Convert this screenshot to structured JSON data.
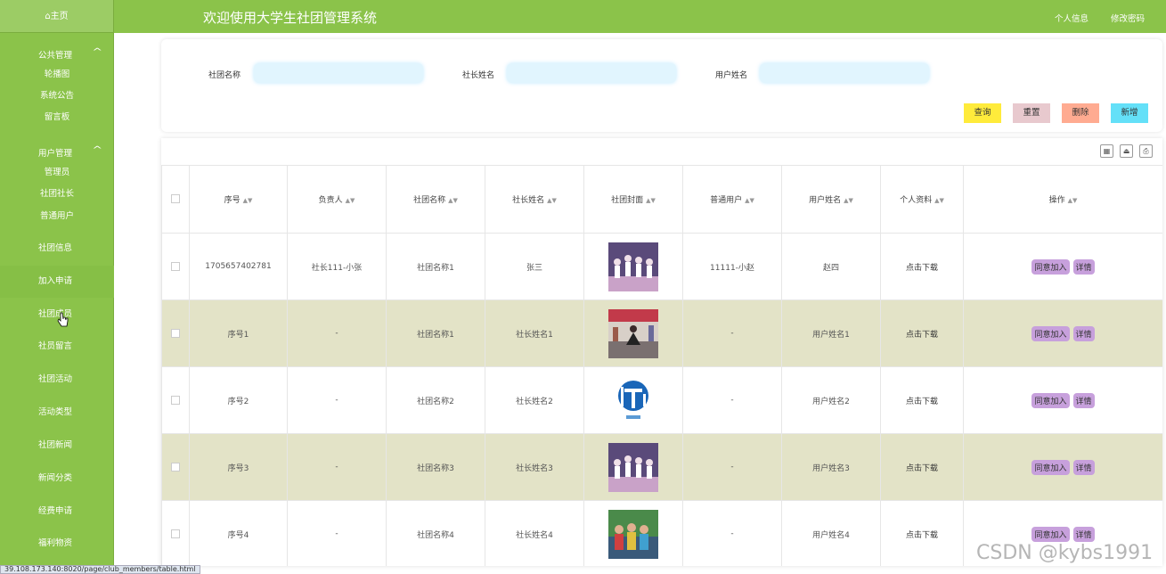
{
  "sidebar": {
    "home": "⌂主页",
    "groups": [
      {
        "label": "公共管理",
        "items": [
          "轮播图",
          "系统公告",
          "留言板"
        ]
      },
      {
        "label": "用户管理",
        "items": [
          "管理员",
          "社团社长",
          "普通用户"
        ]
      }
    ],
    "items": [
      "社团信息",
      "加入申请",
      "社团成员",
      "社员留言",
      "社团活动",
      "活动类型",
      "社团新闻",
      "新闻分类",
      "经费申请",
      "福利物资"
    ],
    "active_index": 1
  },
  "header": {
    "title": "欢迎使用大学生社团管理系统",
    "profile": "个人信息",
    "change_password": "修改密码"
  },
  "search": {
    "club_name_label": "社团名称",
    "president_label": "社长姓名",
    "user_label": "用户姓名",
    "buttons": {
      "query": "查询",
      "reset": "重置",
      "delete": "删除",
      "add": "新增"
    }
  },
  "table": {
    "columns": [
      "序号",
      "负责人",
      "社团名称",
      "社长姓名",
      "社团封面",
      "普通用户",
      "用户姓名",
      "个人资料",
      "操作"
    ],
    "rows": [
      {
        "no": "1705657402781",
        "leader": "社长111-小张",
        "club": "社团名称1",
        "president": "张三",
        "cover": "dance-photo",
        "user": "11111-小赵",
        "username": "赵四",
        "profile": "点击下载"
      },
      {
        "no": "序号1",
        "leader": "-",
        "club": "社团名称1",
        "president": "社长姓名1",
        "cover": "outdoor-dance-photo",
        "user": "-",
        "username": "用户姓名1",
        "profile": "点击下载"
      },
      {
        "no": "序号2",
        "leader": "-",
        "club": "社团名称2",
        "president": "社长姓名2",
        "cover": "logo",
        "user": "-",
        "username": "用户姓名2",
        "profile": "点击下载"
      },
      {
        "no": "序号3",
        "leader": "-",
        "club": "社团名称3",
        "president": "社长姓名3",
        "cover": "dance-photo",
        "user": "-",
        "username": "用户姓名3",
        "profile": "点击下载"
      },
      {
        "no": "序号4",
        "leader": "-",
        "club": "社团名称4",
        "president": "社长姓名4",
        "cover": "group-photo",
        "user": "-",
        "username": "用户姓名4",
        "profile": "点击下载"
      }
    ],
    "actions": {
      "approve": "同意加入",
      "detail": "详情"
    }
  },
  "status_url": "39.108.173.140:8020/page/club_members/table.html",
  "watermark": "CSDN @kybs1991",
  "colors": {
    "accent": "#8bc34a",
    "query": "#ffeb3b",
    "reset": "#e8c9ce",
    "delete": "#ffab91",
    "add": "#64e0f8",
    "row_alt": "#e3e3c7",
    "op_btn": "#c7a0dc"
  }
}
